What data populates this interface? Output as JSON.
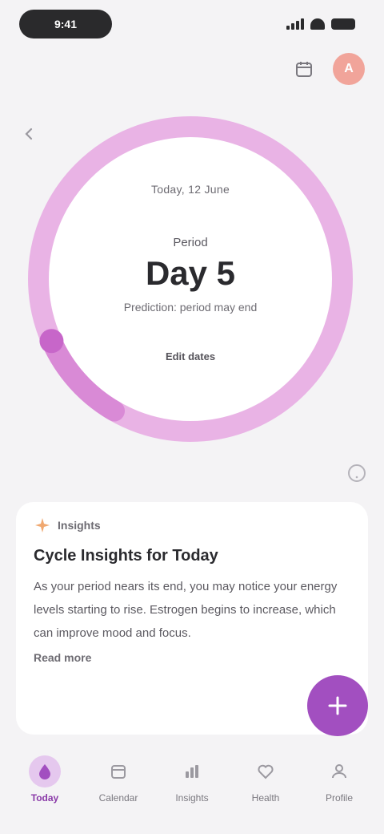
{
  "status_bar": {
    "time": "9:41",
    "icons": [
      "cellular-signal-icon",
      "wifi-icon",
      "battery-icon"
    ]
  },
  "header": {
    "calendar_icon": "calendar-icon",
    "avatar_initial": "A",
    "back_icon": "chevron-left-icon"
  },
  "cycle": {
    "date_text": "Today, 12 June",
    "label": "Period",
    "day": "Day 5",
    "subtext": "Prediction: period may end",
    "link_label": "Edit dates",
    "ring_color": "#d98ad6",
    "progress_fraction": 0.1
  },
  "help_icon": "help-circle-icon",
  "insight": {
    "tag_icon": "sparkle-icon",
    "tag": "Insights",
    "title": "Cycle Insights for Today",
    "body": "As your period nears its end, you may notice your energy levels starting to rise. Estrogen begins to increase, which can improve mood and focus.",
    "link": "Read more"
  },
  "fab": {
    "icon": "plus-icon"
  },
  "colors": {
    "accent": "#a24fc0",
    "accent_light": "#e5c8ee",
    "avatar": "#f1a49a"
  },
  "bottom_nav": [
    {
      "label": "Today",
      "icon": "drop-icon",
      "active": true
    },
    {
      "label": "Calendar",
      "icon": "calendar-icon",
      "active": false
    },
    {
      "label": "Insights",
      "icon": "chart-icon",
      "active": false
    },
    {
      "label": "Health",
      "icon": "heart-icon",
      "active": false
    },
    {
      "label": "Profile",
      "icon": "user-icon",
      "active": false
    }
  ]
}
